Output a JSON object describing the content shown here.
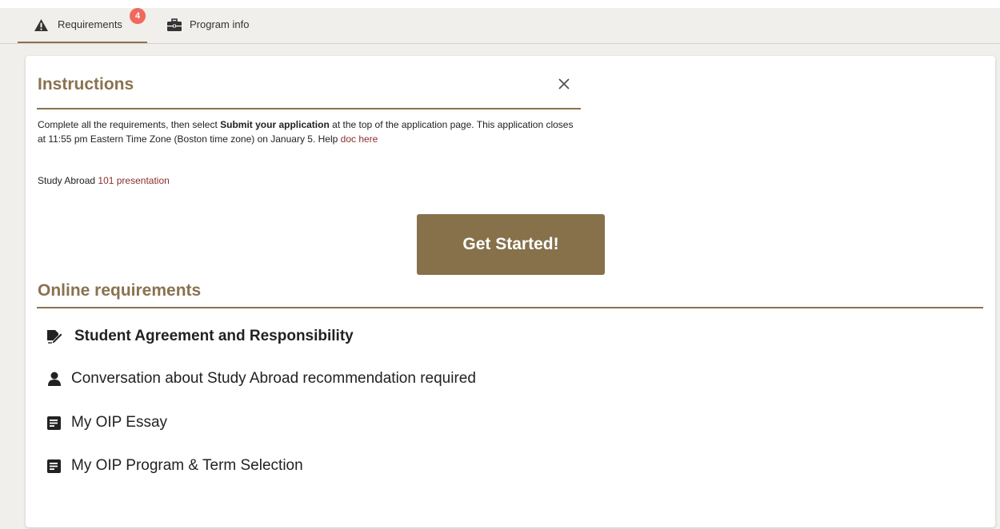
{
  "tabs": {
    "requirements": {
      "label": "Requirements",
      "badge": "4",
      "icon": "warning-icon"
    },
    "program_info": {
      "label": "Program info",
      "icon": "briefcase-icon"
    }
  },
  "instructions": {
    "title": "Instructions",
    "close_icon": "close-icon",
    "text_part1": "Complete all the requirements, then select ",
    "text_bold": "Submit your application",
    "text_part2": " at the top of the application page. This application closes at 11:55 pm Eastern Time Zone (Boston time zone) on January 5. Help ",
    "help_link": "doc here",
    "study_prefix": "Study Abroad ",
    "study_link": "101 presentation"
  },
  "get_started": {
    "label": "Get Started!"
  },
  "online_requirements": {
    "title": "Online requirements",
    "items": [
      {
        "label": "Student Agreement and Responsibility",
        "icon": "signature-icon"
      },
      {
        "label": "Conversation about Study Abroad recommendation required",
        "icon": "person-icon"
      },
      {
        "label": "My OIP Essay",
        "icon": "form-icon"
      },
      {
        "label": "My OIP Program & Term Selection",
        "icon": "form-icon"
      }
    ]
  },
  "colors": {
    "accent": "#8a7250",
    "button": "#86714a",
    "badge": "#f0695e",
    "link": "#8b2e2e"
  }
}
